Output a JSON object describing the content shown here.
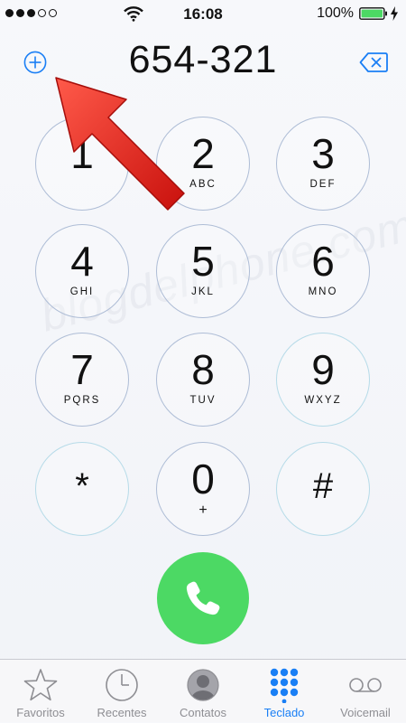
{
  "status": {
    "time": "16:08",
    "battery": "100%",
    "signal_filled": 3,
    "signal_total": 5
  },
  "dialer": {
    "number": "654-321"
  },
  "keys": [
    {
      "digit": "1",
      "letters": ""
    },
    {
      "digit": "2",
      "letters": "ABC"
    },
    {
      "digit": "3",
      "letters": "DEF"
    },
    {
      "digit": "4",
      "letters": "GHI"
    },
    {
      "digit": "5",
      "letters": "JKL"
    },
    {
      "digit": "6",
      "letters": "MNO"
    },
    {
      "digit": "7",
      "letters": "PQRS"
    },
    {
      "digit": "8",
      "letters": "TUV"
    },
    {
      "digit": "9",
      "letters": "WXYZ"
    },
    {
      "digit": "*",
      "letters": ""
    },
    {
      "digit": "0",
      "letters": "+"
    },
    {
      "digit": "#",
      "letters": ""
    }
  ],
  "watermark": "blogdelphone.com",
  "tabs": [
    {
      "label": "Favoritos",
      "icon": "star-icon"
    },
    {
      "label": "Recentes",
      "icon": "clock-icon"
    },
    {
      "label": "Contatos",
      "icon": "contacts-icon"
    },
    {
      "label": "Teclado",
      "icon": "keypad-icon"
    },
    {
      "label": "Voicemail",
      "icon": "voicemail-icon"
    }
  ],
  "active_tab": "Teclado",
  "colors": {
    "accent": "#1a7ff5",
    "call": "#4cd964",
    "key_ring": "#aebdd6",
    "battery": "#4cd964",
    "arrow": "#e8201c"
  }
}
